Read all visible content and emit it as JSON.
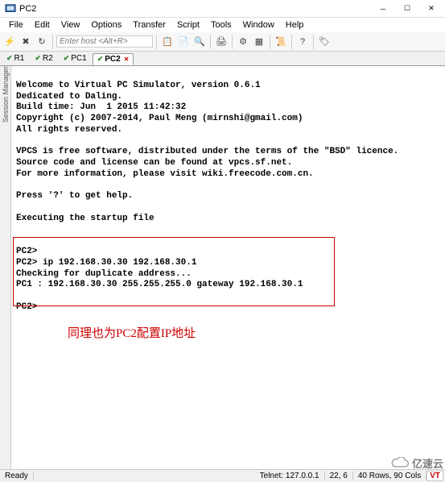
{
  "window": {
    "title": "PC2"
  },
  "menu": {
    "items": [
      "File",
      "Edit",
      "View",
      "Options",
      "Transfer",
      "Script",
      "Tools",
      "Window",
      "Help"
    ]
  },
  "toolbar": {
    "host_placeholder": "Enter host <Alt+R>"
  },
  "tabs": {
    "items": [
      {
        "label": "R1",
        "active": false
      },
      {
        "label": "R2",
        "active": false
      },
      {
        "label": "PC1",
        "active": false
      },
      {
        "label": "PC2",
        "active": true
      }
    ]
  },
  "side_tab": {
    "label": "Session Manager"
  },
  "terminal": {
    "lines": [
      "",
      "Welcome to Virtual PC Simulator, version 0.6.1",
      "Dedicated to Daling.",
      "Build time: Jun  1 2015 11:42:32",
      "Copyright (c) 2007-2014, Paul Meng (mirnshi@gmail.com)",
      "All rights reserved.",
      "",
      "VPCS is free software, distributed under the terms of the \"BSD\" licence.",
      "Source code and license can be found at vpcs.sf.net.",
      "For more information, please visit wiki.freecode.com.cn.",
      "",
      "Press '?' to get help.",
      "",
      "Executing the startup file",
      "",
      "",
      "PC2>",
      "PC2> ip 192.168.30.30 192.168.30.1",
      "Checking for duplicate address...",
      "PC1 : 192.168.30.30 255.255.255.0 gateway 192.168.30.1",
      "",
      "PC2>"
    ]
  },
  "annotation": {
    "text": "同理也为PC2配置IP地址"
  },
  "statusbar": {
    "ready": "Ready",
    "telnet": "Telnet: 127.0.0.1",
    "cursor": "22,   6",
    "size": "40 Rows, 90 Cols",
    "vt": "VT"
  },
  "watermark": {
    "text": "亿速云"
  }
}
